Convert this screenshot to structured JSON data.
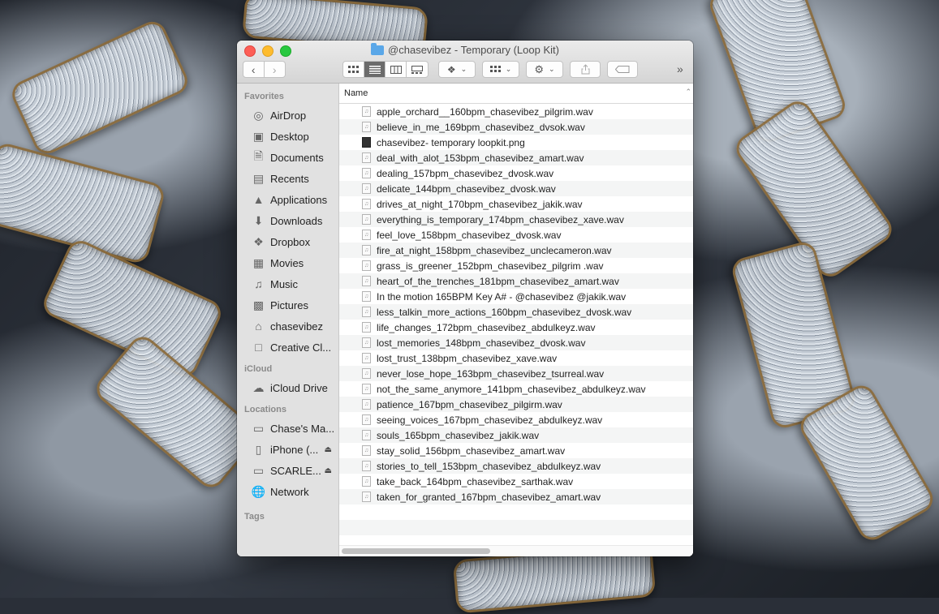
{
  "window": {
    "title": "@chasevibez - Temporary (Loop Kit)"
  },
  "toolbar": {
    "back_icon": "chevron-left-icon",
    "forward_icon": "chevron-right-icon",
    "more": "»"
  },
  "sidebar": {
    "favorites_label": "Favorites",
    "favorites": [
      {
        "label": "AirDrop",
        "icon": "airdrop-icon"
      },
      {
        "label": "Desktop",
        "icon": "desktop-icon"
      },
      {
        "label": "Documents",
        "icon": "documents-icon"
      },
      {
        "label": "Recents",
        "icon": "recents-icon"
      },
      {
        "label": "Applications",
        "icon": "applications-icon"
      },
      {
        "label": "Downloads",
        "icon": "downloads-icon"
      },
      {
        "label": "Dropbox",
        "icon": "dropbox-icon"
      },
      {
        "label": "Movies",
        "icon": "movies-icon"
      },
      {
        "label": "Music",
        "icon": "music-icon"
      },
      {
        "label": "Pictures",
        "icon": "pictures-icon"
      },
      {
        "label": "chasevibez",
        "icon": "home-icon"
      },
      {
        "label": "Creative Cl...",
        "icon": "folder-icon"
      }
    ],
    "icloud_label": "iCloud",
    "icloud": [
      {
        "label": "iCloud Drive",
        "icon": "cloud-icon"
      }
    ],
    "locations_label": "Locations",
    "locations": [
      {
        "label": "Chase's Ma...",
        "icon": "laptop-icon"
      },
      {
        "label": "iPhone (...",
        "icon": "iphone-icon"
      },
      {
        "label": "SCARLE...",
        "icon": "drive-icon"
      },
      {
        "label": "Network",
        "icon": "network-icon"
      }
    ],
    "tags_label": "Tags"
  },
  "list": {
    "column_name": "Name",
    "files": [
      "apple_orchard__160bpm_chasevibez_pilgrim.wav",
      "believe_in_me_169bpm_chasevibez_dvsok.wav",
      "chasevibez- temporary loopkit.png",
      "deal_with_alot_153bpm_chasevibez_amart.wav",
      "dealing_157bpm_chasevibez_dvosk.wav",
      "delicate_144bpm_chasevibez_dvosk.wav",
      "drives_at_night_170bpm_chasevibez_jakik.wav",
      "everything_is_temporary_174bpm_chasevibez_xave.wav",
      "feel_love_158bpm_chasevibez_dvosk.wav",
      "fire_at_night_158bpm_chasevibez_unclecameron.wav",
      "grass_is_greener_152bpm_chasevibez_pilgrim .wav",
      "heart_of_the_trenches_181bpm_chasevibez_amart.wav",
      "In the motion 165BPM Key A# - @chasevibez @jakik.wav",
      "less_talkin_more_actions_160bpm_chasevibez_dvosk.wav",
      "life_changes_172bpm_chasevibez_abdulkeyz.wav",
      "lost_memories_148bpm_chasevibez_dvosk.wav",
      "lost_trust_138bpm_chasevibez_xave.wav",
      "never_lose_hope_163bpm_chasevibez_tsurreal.wav",
      "not_the_same_anymore_141bpm_chasevibez_abdulkeyz.wav",
      "patience_167bpm_chasevibez_pilgirm.wav",
      "seeing_voices_167bpm_chasevibez_abdulkeyz.wav",
      "souls_165bpm_chasevibez_jakik.wav",
      "stay_solid_156bpm_chasevibez_amart.wav",
      "stories_to_tell_153bpm_chasevibez_abdulkeyz.wav",
      "take_back_164bpm_chasevibez_sarthak.wav",
      "taken_for_granted_167bpm_chasevibez_amart.wav"
    ]
  }
}
